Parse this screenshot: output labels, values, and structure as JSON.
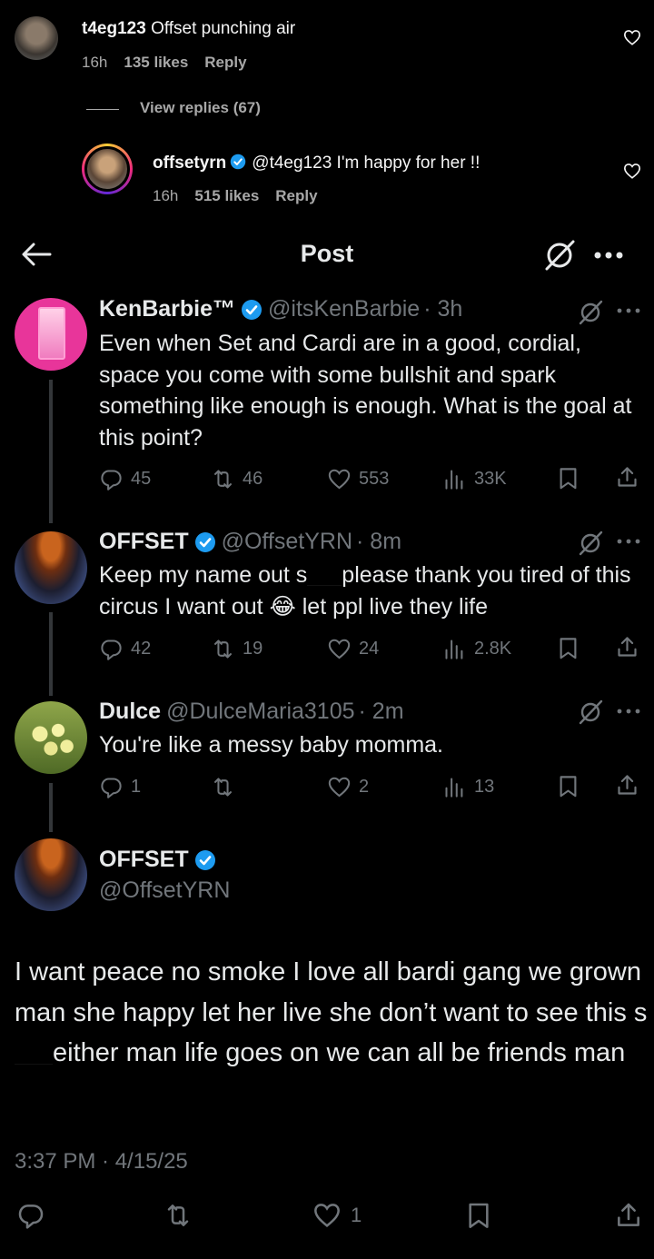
{
  "instagram": {
    "comment": {
      "username": "t4eg123",
      "text": "Offset punching air",
      "time": "16h",
      "likes": "135 likes",
      "reply": "Reply"
    },
    "view_replies": "View replies (67)",
    "reply": {
      "username": "offsetyrn",
      "text": "@t4eg123 I'm happy for her !!",
      "time": "16h",
      "likes": "515 likes",
      "reply": "Reply"
    }
  },
  "header": {
    "title": "Post"
  },
  "tweets": [
    {
      "name": "KenBarbie™",
      "handle": "@itsKenBarbie",
      "time": "· 3h",
      "text": "Even when Set and Cardi are in a good, cordial, space you come with some bullshit and spark something like enough is enough. What is the goal at this point?",
      "replies": "45",
      "reposts": "46",
      "likes": "553",
      "views": "33K"
    },
    {
      "name": "OFFSET",
      "handle": "@OffsetYRN",
      "time": "· 8m",
      "text_a": "Keep my name out s",
      "text_b": "please thank you tired of this circus I want out 😂 let ppl live they life",
      "replies": "42",
      "reposts": "19",
      "likes": "24",
      "views": "2.8K"
    },
    {
      "name": "Dulce",
      "handle": "@DulceMaria3105",
      "time": "· 2m",
      "text": "You're like a messy baby momma.",
      "replies": "1",
      "reposts": "",
      "likes": "2",
      "views": "13"
    }
  ],
  "main_post": {
    "name": "OFFSET",
    "handle": "@OffsetYRN",
    "text_a": "I want peace no smoke I love all bardi gang we grown man she happy let her live she don’t want to see this s",
    "text_b": "either man life goes on we can all be friends man",
    "timestamp": "3:37 PM · 4/15/25",
    "likes": "1"
  },
  "colors": {
    "background": "#000000",
    "text_primary": "#e7e9ea",
    "text_secondary": "#71767b",
    "verified_blue": "#1d9bf0",
    "instagram_meta": "#a8a8a8"
  }
}
